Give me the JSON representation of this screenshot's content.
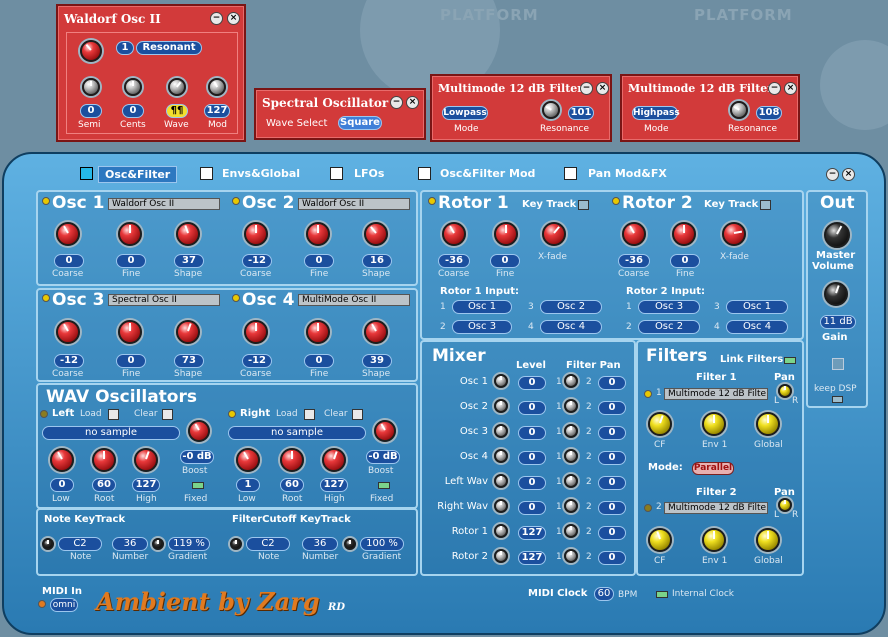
{
  "background": {
    "label1": "PLATFORM",
    "label2": "PLATFORM"
  },
  "osc_win": {
    "title": "Waldorf Osc II",
    "num": "1",
    "mode": "Resonant",
    "vals": [
      "0",
      "0",
      "¶¶",
      "127"
    ],
    "labels": [
      "Semi",
      "Cents",
      "Wave",
      "Mod"
    ]
  },
  "spec_win": {
    "title": "Spectral Oscillator",
    "wave_label": "Wave Select",
    "wave_val": "Square"
  },
  "filt1_win": {
    "title": "Multimode 12 dB Filter",
    "mode_val": "Lowpass",
    "mode_label": "Mode",
    "res_val": "101",
    "res_label": "Resonance"
  },
  "filt2_win": {
    "title": "Multimode 12 dB Filter",
    "mode_val": "Highpass",
    "mode_label": "Mode",
    "res_val": "108",
    "res_label": "Resonance"
  },
  "tabs": [
    "Osc&Filter",
    "Envs&Global",
    "LFOs",
    "Osc&Filter Mod",
    "Pan Mod&FX"
  ],
  "osc": [
    {
      "name": "Osc 1",
      "type": "Waldorf Osc II",
      "vals": [
        "0",
        "0",
        "37"
      ]
    },
    {
      "name": "Osc 2",
      "type": "Waldorf Osc II",
      "vals": [
        "-12",
        "0",
        "16"
      ]
    },
    {
      "name": "Osc 3",
      "type": "Spectral Osc II",
      "vals": [
        "-12",
        "0",
        "73"
      ]
    },
    {
      "name": "Osc 4",
      "type": "MultiMode Osc II",
      "vals": [
        "-12",
        "0",
        "39"
      ]
    }
  ],
  "knob_labels": [
    "Coarse",
    "Fine",
    "Shape"
  ],
  "rotor": [
    {
      "name": "Rotor 1",
      "vals": [
        "-36",
        "0"
      ]
    },
    {
      "name": "Rotor 2",
      "vals": [
        "-36",
        "0"
      ]
    }
  ],
  "rotor_knob_labels": [
    "Coarse",
    "Fine",
    "X-fade"
  ],
  "key_track": "Key Track",
  "rotor1_input": {
    "title": "Rotor 1 Input:",
    "nums": [
      "1",
      "2",
      "3",
      "4"
    ],
    "items": [
      "Osc 1",
      "Osc 3",
      "Osc 2",
      "Osc 4"
    ]
  },
  "rotor2_input": {
    "title": "Rotor 2 Input:",
    "nums": [
      "1",
      "2",
      "3",
      "4"
    ],
    "items": [
      "Osc 3",
      "Osc 2",
      "Osc 1",
      "Osc 4"
    ]
  },
  "wav": {
    "title": "WAV Oscillators",
    "left": "Left",
    "right": "Right",
    "load": "Load",
    "clear": "Clear",
    "no_sample": "no sample",
    "boost": "-0 dB",
    "boost_label": "Boost",
    "left_vals": [
      "0",
      "60",
      "127"
    ],
    "right_vals": [
      "1",
      "60",
      "127"
    ],
    "knob_labels": [
      "Low",
      "Root",
      "High"
    ],
    "fixed": "Fixed"
  },
  "note_kt": {
    "title": "Note KeyTrack",
    "note": "C2",
    "number": "36",
    "gradient": "119 %"
  },
  "fc_kt": {
    "title": "FilterCutoff KeyTrack",
    "note": "C2",
    "number": "36",
    "gradient": "100 %"
  },
  "kt_labels": [
    "Note",
    "Number",
    "Gradient"
  ],
  "mixer": {
    "title": "Mixer",
    "level": "Level",
    "filter_pan": "Filter Pan",
    "rows": [
      {
        "name": "Osc 1",
        "level": "0",
        "pan": "0"
      },
      {
        "name": "Osc 2",
        "level": "0",
        "pan": "0"
      },
      {
        "name": "Osc 3",
        "level": "0",
        "pan": "0"
      },
      {
        "name": "Osc 4",
        "level": "0",
        "pan": "0"
      },
      {
        "name": "Left Wav",
        "level": "0",
        "pan": "0"
      },
      {
        "name": "Right Wav",
        "level": "0",
        "pan": "0"
      },
      {
        "name": "Rotor 1",
        "level": "127",
        "pan": "0"
      },
      {
        "name": "Rotor 2",
        "level": "127",
        "pan": "0"
      }
    ],
    "n1": "1",
    "n2": "2"
  },
  "filters": {
    "title": "Filters",
    "link": "Link Filters",
    "f1_title": "Filter 1",
    "f2_title": "Filter 2",
    "f1_type": "Multimode 12 dB Filte",
    "f2_type": "Multimode 12 dB Filte",
    "pan": "Pan",
    "l": "L",
    "r": "R",
    "n1": "1",
    "n2": "2",
    "knob_labels": [
      "CF",
      "Env 1",
      "Global"
    ],
    "mode_label": "Mode:",
    "mode_val": "Parallel"
  },
  "out": {
    "title": "Out",
    "master": "Master",
    "volume": "Volume",
    "gain_val": "11 dB",
    "gain": "Gain",
    "keep": "keep DSP"
  },
  "midi": {
    "in_label": "MIDI In",
    "in_val": "omni",
    "clock_label": "MIDI Clock",
    "bpm_val": "60",
    "bpm": "BPM",
    "internal": "Internal Clock"
  },
  "logo": {
    "text": "Ambient by Zarg",
    "suffix": "RD"
  }
}
